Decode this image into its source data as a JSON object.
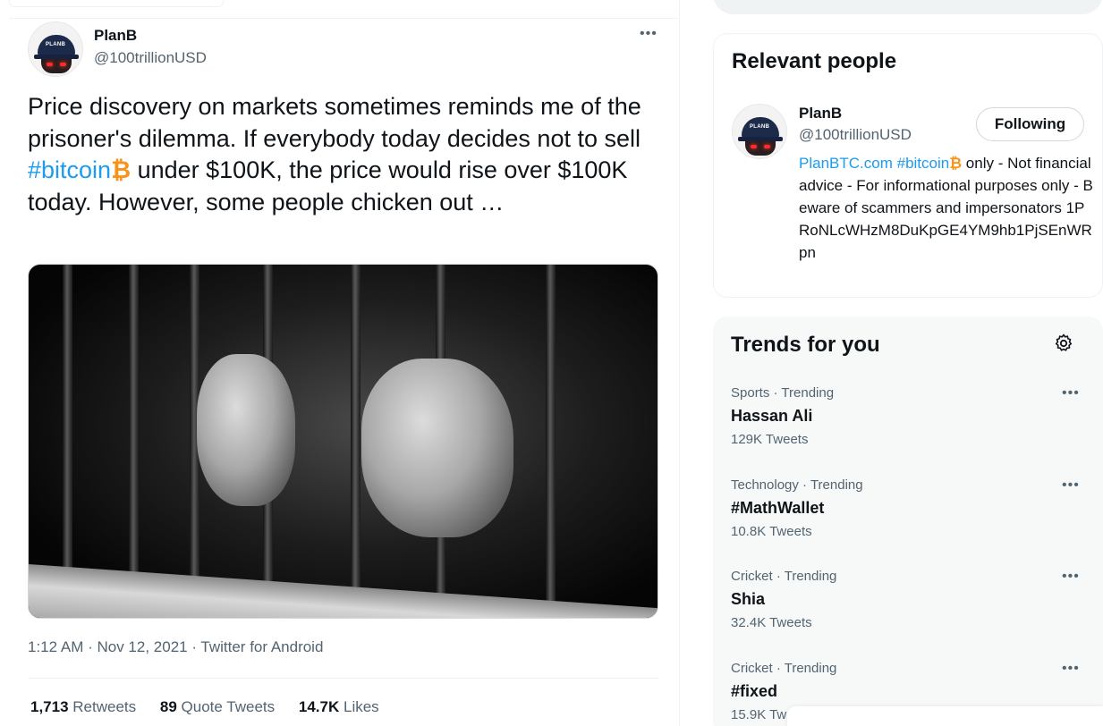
{
  "tweet": {
    "author_name": "PlanB",
    "author_handle": "@100trillionUSD",
    "avatar_cap_text": "PLANB",
    "text_part1": "Price discovery on markets sometimes reminds me of the prisoner's dilemma. If everybody today decides not to sell ",
    "hashtag": "#bitcoin",
    "btc_glyph": "₿",
    "text_part2": " under $100K, the price would rise over $100K today. However, some people chicken out …",
    "timestamp": "1:12 AM · Nov 12, 2021 · Twitter for Android",
    "stats": [
      {
        "count": "1,713",
        "label": "Retweets"
      },
      {
        "count": "89",
        "label": "Quote Tweets"
      },
      {
        "count": "14.7K",
        "label": "Likes"
      }
    ],
    "more_icon": "•••"
  },
  "relevant_people": {
    "title": "Relevant people",
    "person": {
      "name": "PlanB",
      "handle": "@100trillionUSD",
      "follow_label": "Following",
      "bio_link": "PlanBTC.com",
      "bio_hashtag": "#bitcoin",
      "btc_glyph": "₿",
      "bio_rest": " only - Not financial advice - For informational purposes only - Beware of scammers and impersonators 1PRoNLcWHzM8DuKpGE4YM9hb1PjSEnWRpn"
    }
  },
  "trends": {
    "title": "Trends for you",
    "settings_icon": "gear-icon",
    "items": [
      {
        "category": "Sports · Trending",
        "name": "Hassan Ali",
        "count": "129K Tweets"
      },
      {
        "category": "Technology · Trending",
        "name": "#MathWallet",
        "count": "10.8K Tweets"
      },
      {
        "category": "Cricket · Trending",
        "name": "Shia",
        "count": "32.4K Tweets"
      },
      {
        "category": "Cricket · Trending",
        "name": "#fixed",
        "count": "15.9K Tw"
      }
    ]
  },
  "colors": {
    "accent": "#1d9bf0",
    "bitcoin": "#f7931a",
    "secondary_text": "#536471"
  }
}
